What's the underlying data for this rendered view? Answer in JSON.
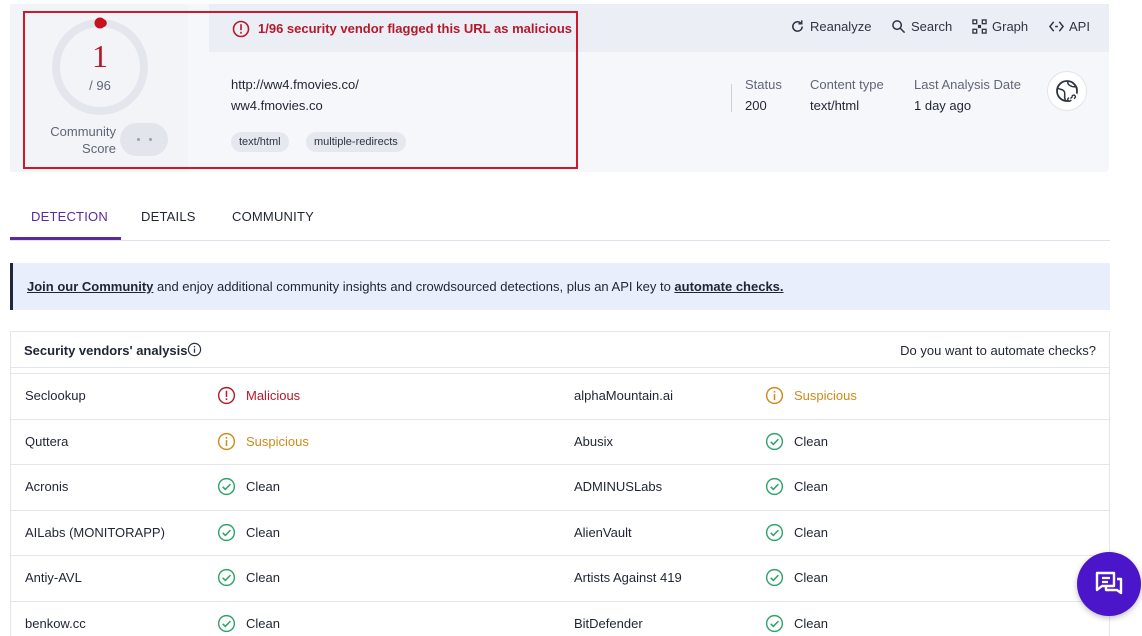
{
  "header": {
    "score": {
      "detections": "1",
      "total": "/ 96",
      "fraction_flagged": 0.0104,
      "community_label_line1": "Community",
      "community_label_line2": "Score"
    },
    "alert_text": "1/96 security vendor flagged this URL as malicious",
    "actions": [
      {
        "label": "Reanalyze",
        "icon": "refresh-icon"
      },
      {
        "label": "Search",
        "icon": "search-icon"
      },
      {
        "label": "Graph",
        "icon": "graph-icon"
      },
      {
        "label": "API",
        "icon": "api-icon"
      }
    ],
    "url": "http://ww4.fmovies.co/",
    "host": "ww4.fmovies.co",
    "tags": [
      "text/html",
      "multiple-redirects"
    ],
    "meta": [
      {
        "label": "Status",
        "value": "200"
      },
      {
        "label": "Content type",
        "value": "text/html"
      },
      {
        "label": "Last Analysis Date",
        "value": "1 day ago"
      }
    ]
  },
  "tabs": [
    "DETECTION",
    "DETAILS",
    "COMMUNITY"
  ],
  "banner": {
    "link1": "Join our Community",
    "middle": " and enjoy additional community insights and crowdsourced detections, plus an API key to ",
    "link2": "automate checks."
  },
  "vendors": {
    "title": "Security vendors' analysis",
    "automate_prompt": "Do you want to automate checks?",
    "rows": [
      {
        "left": {
          "name": "Seclookup",
          "verdict": "Malicious",
          "status": "malicious"
        },
        "right": {
          "name": "alphaMountain.ai",
          "verdict": "Suspicious",
          "status": "suspicious"
        }
      },
      {
        "left": {
          "name": "Quttera",
          "verdict": "Suspicious",
          "status": "suspicious"
        },
        "right": {
          "name": "Abusix",
          "verdict": "Clean",
          "status": "clean"
        }
      },
      {
        "left": {
          "name": "Acronis",
          "verdict": "Clean",
          "status": "clean"
        },
        "right": {
          "name": "ADMINUSLabs",
          "verdict": "Clean",
          "status": "clean"
        }
      },
      {
        "left": {
          "name": "AILabs (MONITORAPP)",
          "verdict": "Clean",
          "status": "clean"
        },
        "right": {
          "name": "AlienVault",
          "verdict": "Clean",
          "status": "clean"
        }
      },
      {
        "left": {
          "name": "Antiy-AVL",
          "verdict": "Clean",
          "status": "clean"
        },
        "right": {
          "name": "Artists Against 419",
          "verdict": "Clean",
          "status": "clean"
        }
      },
      {
        "left": {
          "name": "benkow.cc",
          "verdict": "Clean",
          "status": "clean"
        },
        "right": {
          "name": "BitDefender",
          "verdict": "Clean",
          "status": "clean"
        }
      }
    ]
  },
  "colors": {
    "malicious": "#b7182a",
    "suspicious": "#cf8a1a",
    "clean": "#2ea36a",
    "accent": "#5b2a9c",
    "chat": "#4b15c9"
  }
}
